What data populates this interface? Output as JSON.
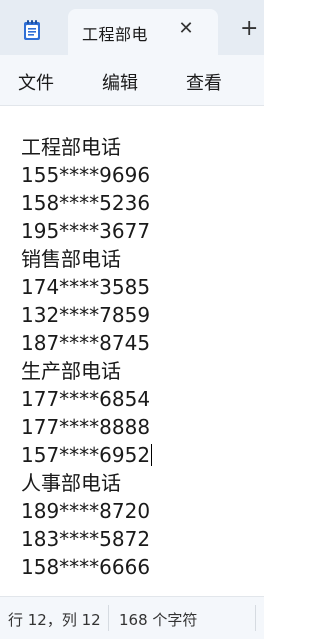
{
  "tab": {
    "title": "工程部电",
    "close_glyph": "✕"
  },
  "new_tab_glyph": "+",
  "icons": {
    "app": "notepad-icon",
    "close": "close-icon",
    "new_tab": "plus-icon"
  },
  "menu": [
    "文件",
    "编辑",
    "查看"
  ],
  "content_lines": [
    "工程部电话",
    "155****9696",
    "158****5236",
    "195****3677",
    "销售部电话",
    "174****3585",
    "132****7859",
    "187****8745",
    "生产部电话",
    "177****6854",
    "177****8888",
    "157****6952",
    "人事部电话",
    "189****8720",
    "183****5872",
    "158****6666"
  ],
  "status": {
    "position": "行 12，列 12",
    "char_count": "168 个字符"
  },
  "colors": {
    "tabbar_bg": "#e6ecf3",
    "active_tab_bg": "#f4f7fb",
    "editor_bg": "#ffffff",
    "icon_blue": "#2f6fd6"
  }
}
